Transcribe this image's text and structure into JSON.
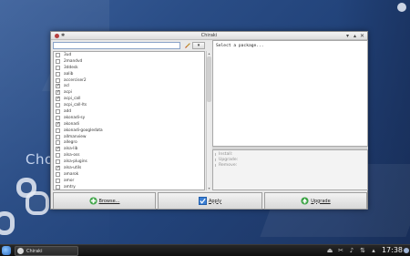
{
  "desktop": {
    "label": "Cho"
  },
  "window": {
    "title": "Chiraki",
    "search": {
      "value": "",
      "placeholder": ""
    },
    "filter_label": "▾",
    "packages": [
      {
        "name": "3ud",
        "checked": false
      },
      {
        "name": "2mandvd",
        "checked": false
      },
      {
        "name": "3ddesk",
        "checked": false
      },
      {
        "name": "aalib",
        "checked": false
      },
      {
        "name": "accerciser2",
        "checked": false
      },
      {
        "name": "acl",
        "checked": true
      },
      {
        "name": "acpi",
        "checked": true
      },
      {
        "name": "acpi_call",
        "checked": true
      },
      {
        "name": "acpi_call-lts",
        "checked": false
      },
      {
        "name": "add",
        "checked": false
      },
      {
        "name": "akonadi-sy",
        "checked": false
      },
      {
        "name": "akonadi",
        "checked": true
      },
      {
        "name": "akonadi-googledata",
        "checked": false
      },
      {
        "name": "allmanview",
        "checked": false
      },
      {
        "name": "allegro",
        "checked": false
      },
      {
        "name": "alsa-lib",
        "checked": true
      },
      {
        "name": "alsa-oss",
        "checked": false
      },
      {
        "name": "alsa-plugins",
        "checked": false
      },
      {
        "name": "alsa-utils",
        "checked": true
      },
      {
        "name": "amarok",
        "checked": false
      },
      {
        "name": "amor",
        "checked": false
      },
      {
        "name": "amtry",
        "checked": false
      },
      {
        "name": "amtr2",
        "checked": false
      }
    ],
    "description": "Select a package...",
    "status": {
      "install": "Install:",
      "upgrade": "Upgrade:",
      "remove": "Remove:"
    },
    "buttons": {
      "browse": "Browse...",
      "apply": "Apply",
      "upgrade": "Upgrade"
    }
  },
  "taskbar": {
    "task_label": "Chiraki",
    "clock": "17:38"
  },
  "colors": {
    "accent": "#2b6cc4",
    "desktop": "#2a4d86",
    "taskbar": "#141414"
  }
}
